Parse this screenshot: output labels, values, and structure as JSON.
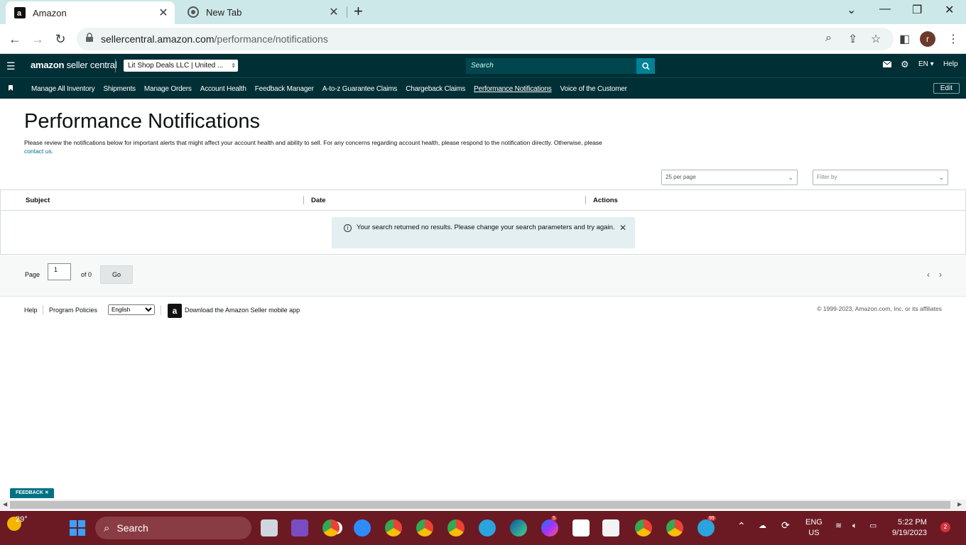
{
  "browser": {
    "tabs": [
      {
        "title": "Amazon",
        "active": true
      },
      {
        "title": "New Tab",
        "active": false
      }
    ],
    "url_host": "sellercentral.amazon.com",
    "url_path": "/performance/notifications",
    "profile_initial": "r"
  },
  "header": {
    "logo_bold": "amazon",
    "logo_light": " seller central",
    "account": "Lit Shop Deals LLC | United ...",
    "search_placeholder": "Search",
    "language": "EN",
    "help": "Help"
  },
  "nav": {
    "items": [
      "Manage All Inventory",
      "Shipments",
      "Manage Orders",
      "Account Health",
      "Feedback Manager",
      "A-to-z Guarantee Claims",
      "Chargeback Claims",
      "Performance Notifications",
      "Voice of the Customer"
    ],
    "current_index": 7,
    "edit": "Edit"
  },
  "page": {
    "title": "Performance Notifications",
    "intro": "Please review the notifications below for important alerts that might affect your account health and ability to sell. For any concerns regarding account health, please respond to the notification directly. Otherwise, please",
    "intro_link": "contact us.",
    "per_page": "25 per page",
    "filter_placeholder": "Filter by"
  },
  "table": {
    "columns": [
      "Subject",
      "Date",
      "Actions"
    ],
    "alert": "Your search returned no results. Please change your search parameters and try again."
  },
  "pager": {
    "page_label": "Page",
    "page_value": "1",
    "of_label": "of 0",
    "go": "Go"
  },
  "footer": {
    "help": "Help",
    "policies": "Program Policies",
    "language": "English",
    "app": "Download the Amazon Seller mobile app",
    "copyright": "© 1999-2023, Amazon.com, Inc. or its affiliates"
  },
  "feedback_tab": "FEEDBACK",
  "taskbar": {
    "temperature": "29°",
    "search": "Search",
    "lang_top": "ENG",
    "lang_bottom": "US",
    "time": "5:22 PM",
    "date": "9/19/2023",
    "notifications": "2",
    "messenger_badge": "5",
    "telegram_badge": "99"
  }
}
